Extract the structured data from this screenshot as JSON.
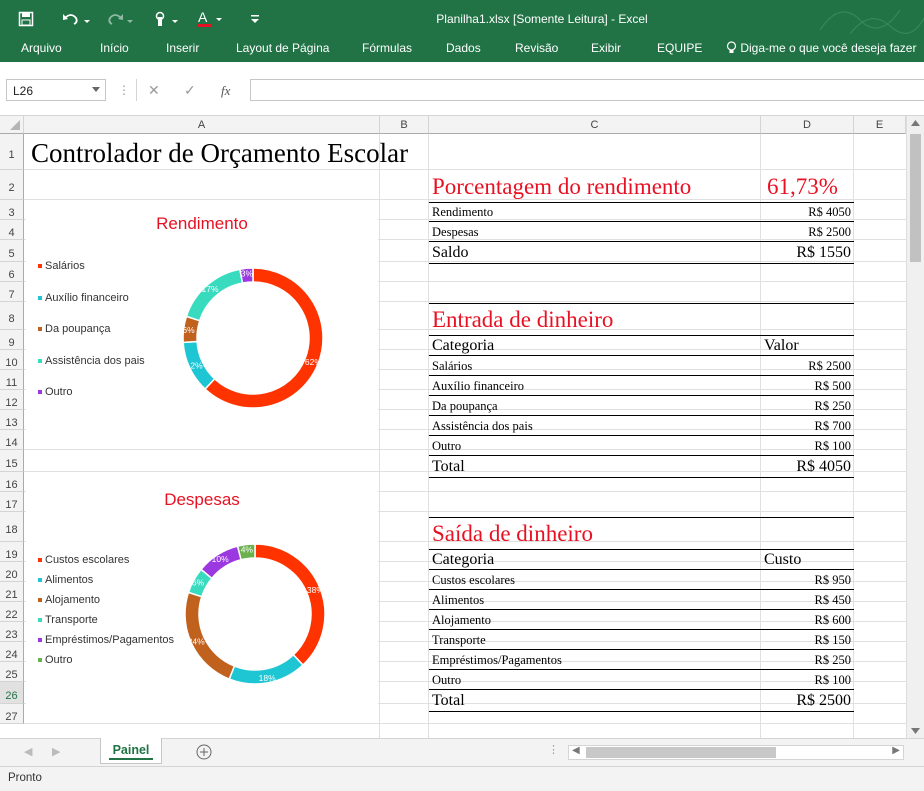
{
  "window": {
    "title": "Planilha1.xlsx [Somente Leitura] - Excel"
  },
  "ribbon": {
    "tabs": [
      "Arquivo",
      "Início",
      "Inserir",
      "Layout de Página",
      "Fórmulas",
      "Dados",
      "Revisão",
      "Exibir",
      "EQUIPE"
    ],
    "tell_me": "Diga-me o que você deseja fazer"
  },
  "formula_bar": {
    "name_box": "L26",
    "fx": "fx",
    "value": ""
  },
  "columns": [
    "A",
    "B",
    "C",
    "D",
    "E"
  ],
  "rows": [
    "1",
    "2",
    "3",
    "4",
    "5",
    "6",
    "7",
    "8",
    "9",
    "10",
    "11",
    "12",
    "13",
    "14",
    "15",
    "16",
    "17",
    "18",
    "19",
    "20",
    "21",
    "22",
    "23",
    "24",
    "25",
    "26",
    "27"
  ],
  "sheet": {
    "title": "Controlador de Orçamento Escolar",
    "summary": {
      "title": "Porcentagem do rendimento",
      "percent": "61,73%",
      "rows": [
        {
          "label": "Rendimento",
          "value": "R$ 4050"
        },
        {
          "label": "Despesas",
          "value": "R$ 2500"
        }
      ],
      "saldo_label": "Saldo",
      "saldo_value": "R$ 1550"
    },
    "income": {
      "title": "Entrada de dinheiro",
      "col1": "Categoria",
      "col2": "Valor",
      "rows": [
        {
          "label": "Salários",
          "value": "R$ 2500"
        },
        {
          "label": "Auxílio financeiro",
          "value": "R$ 500"
        },
        {
          "label": "Da poupança",
          "value": "R$ 250"
        },
        {
          "label": "Assistência dos pais",
          "value": "R$ 700"
        },
        {
          "label": "Outro",
          "value": "R$ 100"
        }
      ],
      "total_label": "Total",
      "total_value": "R$ 4050"
    },
    "expenses": {
      "title": "Saída de dinheiro",
      "col1": "Categoria",
      "col2": "Custo",
      "rows": [
        {
          "label": "Custos escolares",
          "value": "R$ 950"
        },
        {
          "label": "Alimentos",
          "value": "R$ 450"
        },
        {
          "label": "Alojamento",
          "value": "R$ 600"
        },
        {
          "label": "Transporte",
          "value": "R$ 150"
        },
        {
          "label": "Empréstimos/Pagamentos",
          "value": "R$ 250"
        },
        {
          "label": "Outro",
          "value": "R$ 100"
        }
      ],
      "total_label": "Total",
      "total_value": "R$ 2500"
    }
  },
  "chart_data": [
    {
      "type": "pie",
      "title": "Rendimento",
      "categories": [
        "Salários",
        "Auxílio financeiro",
        "Da poupança",
        "Assistência dos pais",
        "Outro"
      ],
      "values": [
        62,
        12,
        6,
        17,
        3
      ],
      "labels": [
        "62%",
        "12%",
        "6%",
        "17%",
        "3%"
      ],
      "colors": [
        "#ff3300",
        "#1ec6d4",
        "#c0611e",
        "#39dbbf",
        "#9b38e0"
      ]
    },
    {
      "type": "pie",
      "title": "Despesas",
      "categories": [
        "Custos escolares",
        "Alimentos",
        "Alojamento",
        "Transporte",
        "Empréstimos/Pagamentos",
        "Outro"
      ],
      "values": [
        38,
        18,
        24,
        6,
        10,
        4
      ],
      "labels": [
        "38%",
        "18%",
        "24%",
        "6%",
        "10%",
        "4%"
      ],
      "colors": [
        "#ff3300",
        "#1ec6d4",
        "#c0611e",
        "#39dbbf",
        "#9b38e0",
        "#6ab04c"
      ]
    }
  ],
  "sheet_tabs": {
    "active": "Painel"
  },
  "status": {
    "text": "Pronto"
  }
}
